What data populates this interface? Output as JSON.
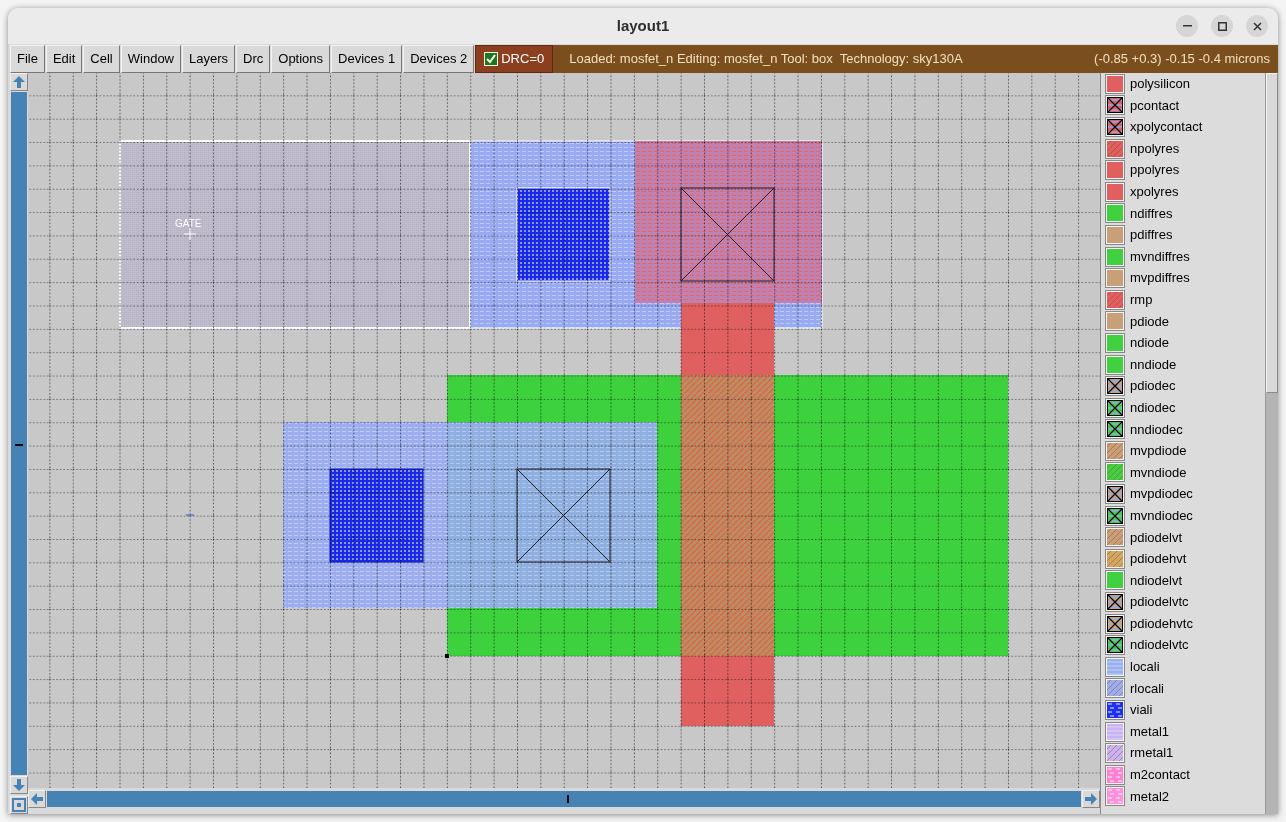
{
  "window": {
    "title": "layout1"
  },
  "menu": [
    "File",
    "Edit",
    "Cell",
    "Window",
    "Layers",
    "Drc",
    "Options",
    "Devices 1",
    "Devices 2"
  ],
  "drc": {
    "checked": true,
    "label": "DRC=0"
  },
  "status": {
    "message": "Loaded: mosfet_n Editing: mosfet_n Tool: box  Technology: sky130A",
    "coordinates": "(-0.85 +0.3) -0.15 -0.4 microns"
  },
  "canvas": {
    "label": "GATE"
  },
  "layers": [
    {
      "name": "polysilicon",
      "kind": "solid",
      "color": "#e06060"
    },
    {
      "name": "pcontact",
      "kind": "contact",
      "color": "#e06060"
    },
    {
      "name": "xpolycontact",
      "kind": "contact",
      "color": "#e06060"
    },
    {
      "name": "npolyres",
      "kind": "hatch",
      "color": "#e06060"
    },
    {
      "name": "ppolyres",
      "kind": "solid",
      "color": "#e06060"
    },
    {
      "name": "xpolyres",
      "kind": "solid",
      "color": "#e06060"
    },
    {
      "name": "ndiffres",
      "kind": "solid",
      "color": "#40d040"
    },
    {
      "name": "pdiffres",
      "kind": "solid",
      "color": "#c8a078"
    },
    {
      "name": "mvndiffres",
      "kind": "solid",
      "color": "#40d040"
    },
    {
      "name": "mvpdiffres",
      "kind": "solid",
      "color": "#c8a078"
    },
    {
      "name": "rmp",
      "kind": "hatch",
      "color": "#e06060"
    },
    {
      "name": "pdiode",
      "kind": "solid",
      "color": "#c8a078"
    },
    {
      "name": "ndiode",
      "kind": "solid",
      "color": "#40d040"
    },
    {
      "name": "nndiode",
      "kind": "solid",
      "color": "#40d040"
    },
    {
      "name": "pdiodec",
      "kind": "contact",
      "color": "#c8a078"
    },
    {
      "name": "ndiodec",
      "kind": "contact",
      "color": "#40d040"
    },
    {
      "name": "nndiodec",
      "kind": "contact",
      "color": "#40d040"
    },
    {
      "name": "mvpdiode",
      "kind": "hatch",
      "color": "#c8a078"
    },
    {
      "name": "mvndiode",
      "kind": "hatch",
      "color": "#40d040"
    },
    {
      "name": "mvpdiodec",
      "kind": "contact",
      "color": "#c8a078"
    },
    {
      "name": "mvndiodec",
      "kind": "contact",
      "color": "#40d040"
    },
    {
      "name": "pdiodelvt",
      "kind": "hatch",
      "color": "#c8a078"
    },
    {
      "name": "pdiodehvt",
      "kind": "hatch",
      "color": "#d0a860"
    },
    {
      "name": "ndiodelvt",
      "kind": "solid",
      "color": "#40d040"
    },
    {
      "name": "pdiodelvtc",
      "kind": "contact",
      "color": "#c8a078"
    },
    {
      "name": "pdiodehvtc",
      "kind": "contact",
      "color": "#d0a860"
    },
    {
      "name": "ndiodelvtc",
      "kind": "contact",
      "color": "#40d040"
    },
    {
      "name": "locali",
      "kind": "stripes",
      "color": "#98b0f0"
    },
    {
      "name": "rlocali",
      "kind": "hatch",
      "color": "#98b0f0"
    },
    {
      "name": "viali",
      "kind": "dots",
      "color": "#2030f0"
    },
    {
      "name": "metal1",
      "kind": "stripes",
      "color": "#c8b4f0"
    },
    {
      "name": "rmetal1",
      "kind": "hatch",
      "color": "#c8b4f0"
    },
    {
      "name": "m2contact",
      "kind": "dots",
      "color": "#ff80d0"
    },
    {
      "name": "metal2",
      "kind": "dots",
      "color": "#ff90d8"
    }
  ]
}
